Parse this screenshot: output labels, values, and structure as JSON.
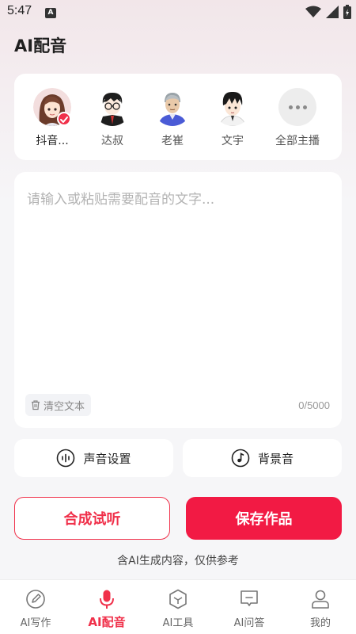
{
  "status_bar": {
    "time": "5:47",
    "notification_icon": "A"
  },
  "page": {
    "title": "AI配音"
  },
  "anchors": [
    {
      "name": "抖音...",
      "selected": true,
      "icon": "avatar-girl"
    },
    {
      "name": "达叔",
      "selected": false,
      "icon": "avatar-glasses-man"
    },
    {
      "name": "老崔",
      "selected": false,
      "icon": "avatar-older-man"
    },
    {
      "name": "文宇",
      "selected": false,
      "icon": "avatar-young-man"
    },
    {
      "name": "全部主播",
      "selected": false,
      "icon": "more-dots-icon"
    }
  ],
  "editor": {
    "placeholder": "请输入或粘贴需要配音的文字...",
    "value": "",
    "clear_label": "清空文本",
    "char_count": "0/5000"
  },
  "settings": {
    "voice_label": "声音设置",
    "bgm_label": "背景音"
  },
  "actions": {
    "synthesize_label": "合成试听",
    "save_label": "保存作品"
  },
  "disclaimer": "含AI生成内容，仅供参考",
  "tabs": [
    {
      "label": "AI写作",
      "icon": "pencil-icon",
      "active": false
    },
    {
      "label": "AI配音",
      "icon": "microphone-icon",
      "active": true
    },
    {
      "label": "AI工具",
      "icon": "cube-icon",
      "active": false
    },
    {
      "label": "AI问答",
      "icon": "chat-icon",
      "active": false
    },
    {
      "label": "我的",
      "icon": "person-icon",
      "active": false
    }
  ],
  "colors": {
    "accent": "#f0304a",
    "save_button": "#f21a44",
    "background": "#f6f6f8"
  }
}
